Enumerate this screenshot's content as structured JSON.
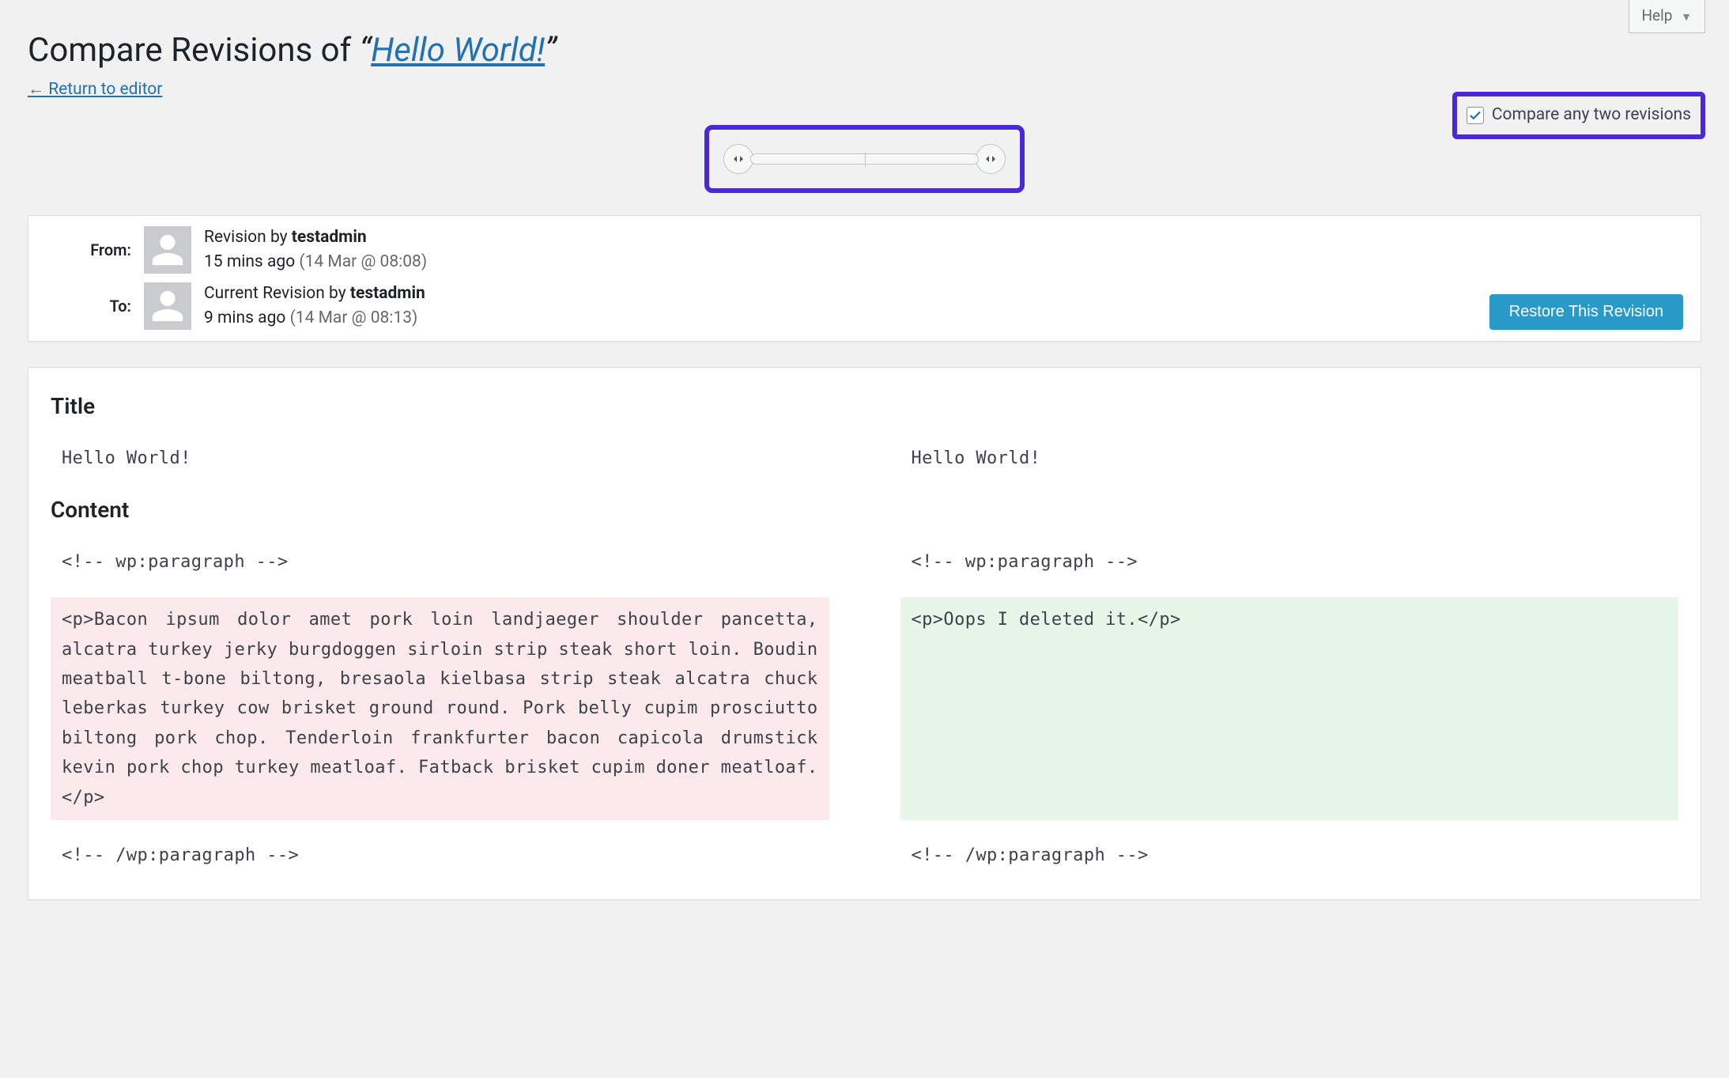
{
  "help": {
    "label": "Help"
  },
  "heading": {
    "prefix": "Compare Revisions of ",
    "quote_open": "“",
    "link_text": "Hello World!",
    "quote_close": "”"
  },
  "return_link": "← Return to editor",
  "compare_any": {
    "label": "Compare any two revisions",
    "checked": true
  },
  "meta": {
    "from_label": "From:",
    "to_label": "To:",
    "from": {
      "line1_prefix": "Revision by ",
      "author": "testadmin",
      "relative": "15 mins ago ",
      "absolute": "(14 Mar @ 08:08)"
    },
    "to": {
      "line1_prefix": "Current Revision by ",
      "author": "testadmin",
      "relative": "9 mins ago ",
      "absolute": "(14 Mar @ 08:13)"
    },
    "restore_button": "Restore This Revision"
  },
  "diff": {
    "title_heading": "Title",
    "content_heading": "Content",
    "title": {
      "left": "Hello World!",
      "right": "Hello World!"
    },
    "content": {
      "left": {
        "open_tag": "<!-- wp:paragraph -->",
        "body": "<p>Bacon ipsum dolor amet pork loin landjaeger shoulder pancetta, alcatra turkey jerky burgdoggen sirloin strip steak short loin. Boudin meatball t-bone biltong, bresaola kielbasa strip steak alcatra chuck leberkas turkey cow brisket ground round. Pork belly cupim prosciutto biltong pork chop. Tenderloin frankfurter bacon capicola drumstick kevin pork chop turkey meatloaf. Fatback brisket cupim doner meatloaf.</p>",
        "close_tag": "<!-- /wp:paragraph -->"
      },
      "right": {
        "open_tag": "<!-- wp:paragraph -->",
        "body": "<p>Oops I deleted it.</p>",
        "close_tag": "<!-- /wp:paragraph -->"
      }
    }
  },
  "colors": {
    "highlight_border": "#4b28d7",
    "link": "#2271b1",
    "primary_btn": "#2999c8",
    "removed_bg": "#fbe9eb",
    "added_bg": "#e8f6ea"
  }
}
